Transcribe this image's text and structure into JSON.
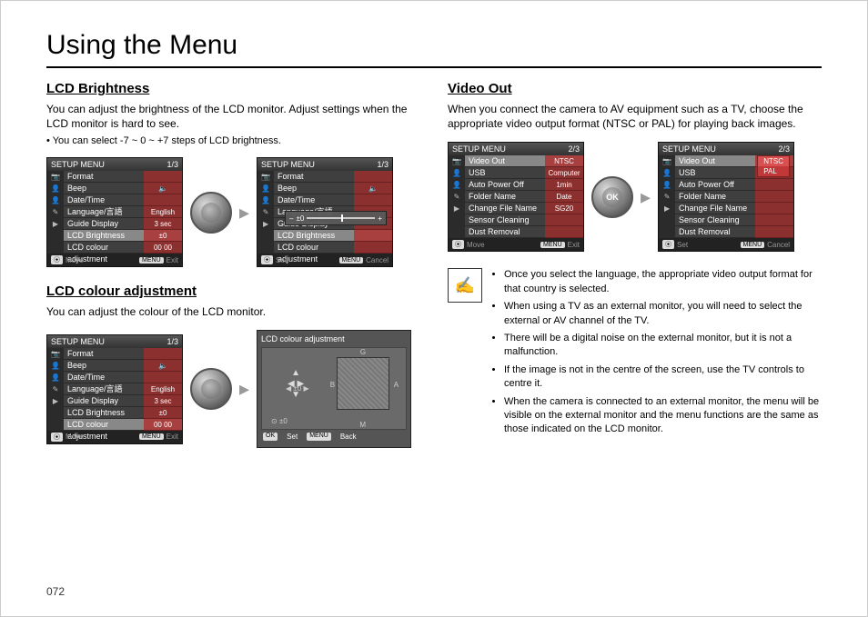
{
  "page": {
    "title": "Using the Menu",
    "number": "072"
  },
  "lcd_brightness": {
    "heading": "LCD Brightness",
    "desc": "You can adjust the brightness of the LCD monitor. Adjust settings when the LCD monitor is hard to see.",
    "note": "• You can select -7 ~ 0 ~ +7 steps of LCD brightness.",
    "menu1": {
      "title": "SETUP MENU",
      "page": "1/3",
      "rows": [
        {
          "label": "Format",
          "val": ""
        },
        {
          "label": "Beep",
          "val": "🔈"
        },
        {
          "label": "Date/Time",
          "val": ""
        },
        {
          "label": "Language/言語",
          "val": "English"
        },
        {
          "label": "Guide Display",
          "val": "3 sec"
        },
        {
          "label": "LCD Brightness",
          "val": "±0",
          "sel": true
        },
        {
          "label": "LCD colour adjustment",
          "val": "00 00"
        }
      ],
      "foot_l": "Move",
      "foot_r": "Exit",
      "key_l": "⦿",
      "key_r": "MENU"
    },
    "menu2": {
      "title": "SETUP MENU",
      "page": "1/3",
      "rows": [
        {
          "label": "Format",
          "val": ""
        },
        {
          "label": "Beep",
          "val": "🔈"
        },
        {
          "label": "Date/Time",
          "val": ""
        },
        {
          "label": "Language/言語",
          "val": ""
        },
        {
          "label": "Guide Display",
          "val": ""
        },
        {
          "label": "LCD Brightness",
          "val": "",
          "sel": true
        },
        {
          "label": "LCD colour adjustment",
          "val": ""
        }
      ],
      "slider": {
        "minus": "–",
        "label": "±0",
        "plus": "+"
      },
      "foot_l": "Set",
      "foot_r": "Cancel",
      "key_l": "⦿",
      "key_r": "MENU"
    }
  },
  "lcd_colour": {
    "heading": "LCD colour adjustment",
    "desc": "You can adjust the colour of the LCD monitor.",
    "menu": {
      "title": "SETUP MENU",
      "page": "1/3",
      "rows": [
        {
          "label": "Format",
          "val": ""
        },
        {
          "label": "Beep",
          "val": "🔈"
        },
        {
          "label": "Date/Time",
          "val": ""
        },
        {
          "label": "Language/言語",
          "val": "English"
        },
        {
          "label": "Guide Display",
          "val": "3 sec"
        },
        {
          "label": "LCD Brightness",
          "val": "±0"
        },
        {
          "label": "LCD colour adjustment",
          "val": "00 00",
          "sel": true
        }
      ],
      "foot_l": "Move",
      "foot_r": "Exit",
      "key_l": "⦿",
      "key_r": "MENU"
    },
    "adjust": {
      "title": "LCD colour adjustment",
      "axis_g": "G",
      "axis_b": "B",
      "axis_a": "A",
      "axis_m": "M",
      "val1": "±0",
      "val2": "±0",
      "ok": "OK",
      "set": "Set",
      "menu": "MENU",
      "back": "Back"
    }
  },
  "video_out": {
    "heading": "Video Out",
    "desc": "When you connect the camera to AV equipment such as a TV, choose the appropriate video output format (NTSC or PAL) for playing back images.",
    "menu1": {
      "title": "SETUP MENU",
      "page": "2/3",
      "rows": [
        {
          "label": "Video Out",
          "val": "NTSC",
          "sel": true
        },
        {
          "label": "USB",
          "val": "Computer"
        },
        {
          "label": "Auto Power Off",
          "val": "1min"
        },
        {
          "label": "Folder Name",
          "val": "Date"
        },
        {
          "label": "Change File Name",
          "val": "SG20"
        },
        {
          "label": "Sensor Cleaning",
          "val": ""
        },
        {
          "label": "Dust Removal",
          "val": ""
        }
      ],
      "foot_l": "Move",
      "foot_r": "Exit",
      "key_l": "⦿",
      "key_r": "MENU"
    },
    "menu2": {
      "title": "SETUP MENU",
      "page": "2/3",
      "rows": [
        {
          "label": "Video Out",
          "val": "NTSC",
          "sel": true
        },
        {
          "label": "USB",
          "val": ""
        },
        {
          "label": "Auto Power Off",
          "val": ""
        },
        {
          "label": "Folder Name",
          "val": ""
        },
        {
          "label": "Change File Name",
          "val": ""
        },
        {
          "label": "Sensor Cleaning",
          "val": ""
        },
        {
          "label": "Dust Removal",
          "val": ""
        }
      ],
      "dropdown": [
        "NTSC",
        "PAL"
      ],
      "foot_l": "Set",
      "foot_r": "Cancel",
      "key_l": "⦿",
      "key_r": "MENU"
    },
    "notes": [
      "Once you select the language, the appropriate video output format for that country is selected.",
      "When using a TV as an external monitor, you will need to select the external or AV channel of the TV.",
      "There will be a digital noise on the external monitor, but it is not a malfunction.",
      "If the image is not in the centre of the screen, use the TV controls to centre it.",
      "When the camera is connected to an external monitor, the menu will be visible on the external monitor and the menu functions are the same as those indicated on the LCD monitor."
    ]
  },
  "icons_col": [
    "📷",
    "👤1",
    "👤2",
    "✎",
    "▶"
  ]
}
